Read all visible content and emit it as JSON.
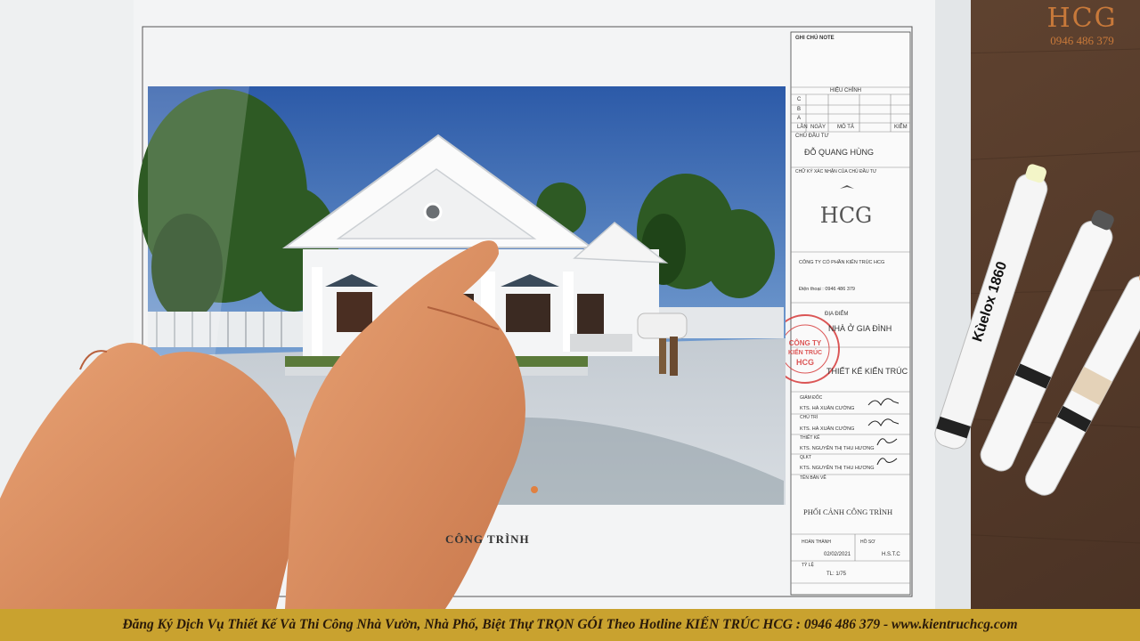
{
  "brand": {
    "logo_text": "HCG",
    "hotline": "0946 486 379",
    "color": "#c8793a"
  },
  "banner": {
    "text": "Đăng Ký Dịch Vụ Thiết Kế Và Thi Công Nhà Vườn, Nhà Phố, Biệt Thự TRỌN GÓI Theo Hotline KIẾN TRÚC HCG : 0946 486 379 - www.kientruchcg.com",
    "color": "#c9a22f"
  },
  "sheet": {
    "caption": "PHỐI CẢNH CÔNG TRÌNH",
    "caption_partial": "CÔNG TRÌNH",
    "notes_title": "GHI CHÚ NOTE",
    "revision_title": "HIỆU CHỈNH",
    "revision_cols": [
      "LẦN",
      "NGÀY",
      "MÔ TẢ",
      "KIỂM"
    ],
    "revision_rows": [
      "C",
      "B",
      "A"
    ],
    "investor_label": "CHỦ ĐẦU TƯ",
    "investor_name": "ĐỖ QUANG HÙNG",
    "investor_sign_label": "CHỮ KÝ XÁC NHẬN CỦA CHỦ ĐẦU TƯ",
    "company_name": "CÔNG TY CỔ PHẦN KIẾN TRÚC HCG",
    "company_phone": "Điện thoại : 0946 486 379",
    "location_label": "ĐỊA ĐIỂM",
    "project": "NHÀ Ở GIA ĐÌNH",
    "phase": "THIẾT KẾ KIẾN TRÚC",
    "director_label": "GIÁM ĐỐC",
    "director": "KTS. HÀ XUÂN CƯỜNG",
    "chief_label": "CHỦ TRÌ",
    "chief": "KTS. HÀ XUÂN CƯỜNG",
    "designer_label": "THIẾT KẾ",
    "designer": "KTS. NGUYỄN THỊ THU HƯƠNG",
    "qc_label": "QLKT",
    "qc": "KTS. NGUYỄN THỊ THU HƯƠNG",
    "drawing_label": "TÊN BẢN VẼ",
    "completed_label": "HOÀN THÀNH",
    "date": "02/02/2021",
    "file_label": "HỒ SƠ",
    "file_code": "H.S.T.C",
    "scale_label": "TỶ LỆ",
    "scale": "TL: 1/75"
  },
  "marker": {
    "brand": "Kùelox",
    "model": "1860"
  }
}
